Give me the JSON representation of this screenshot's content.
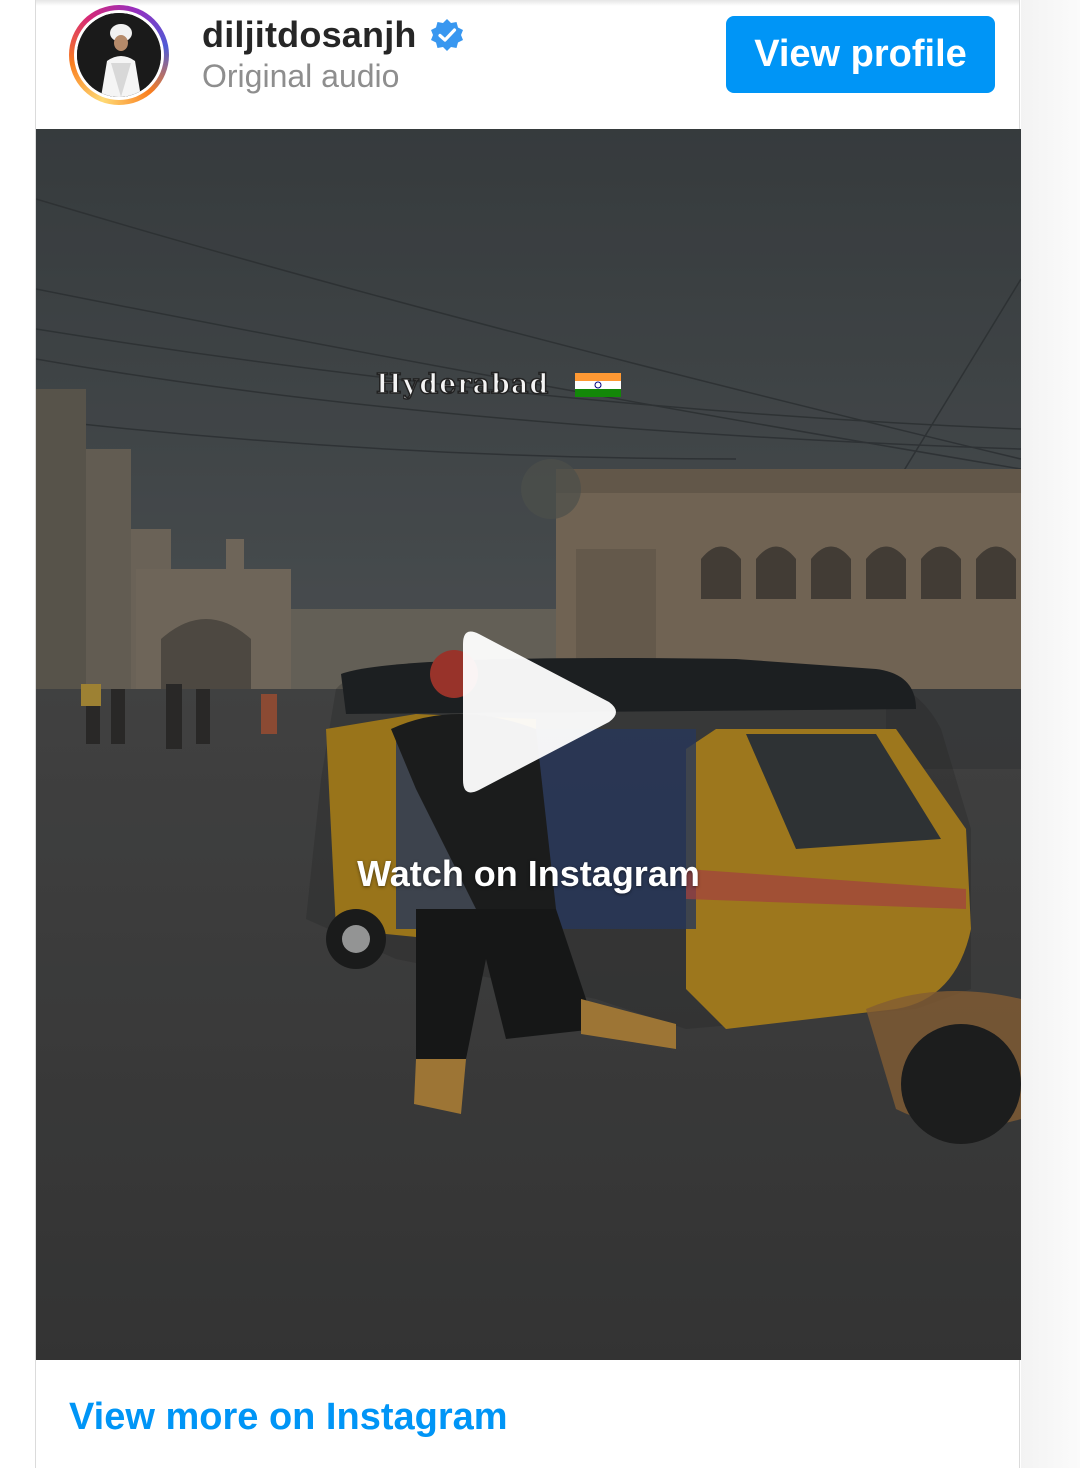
{
  "header": {
    "username": "diljitdosanjh",
    "subtitle": "Original audio",
    "view_profile_label": "View profile"
  },
  "video": {
    "overlay_text": "Hyderabad",
    "watch_label": "Watch on Instagram"
  },
  "footer": {
    "view_more_label": "View more on Instagram"
  },
  "colors": {
    "accent": "#0095f6",
    "verified": "#3897f0"
  },
  "icons": {
    "verified": "verified-badge-icon",
    "play": "play-icon",
    "flag": "india-flag-icon"
  }
}
